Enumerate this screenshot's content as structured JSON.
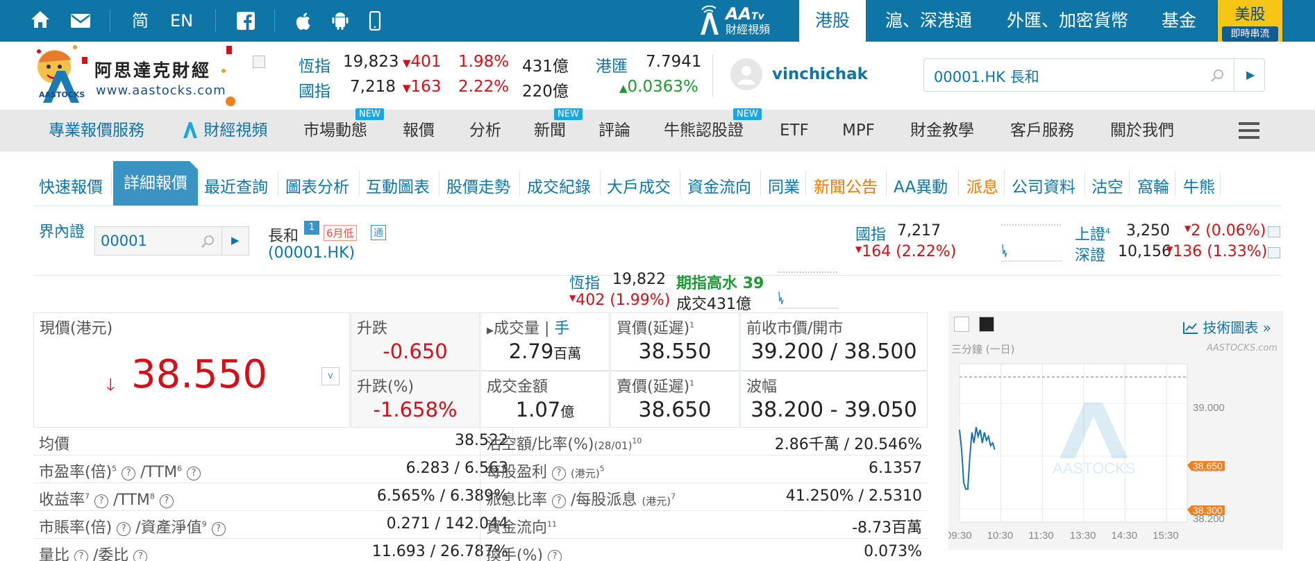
{
  "topbar": {
    "home_icon": "home-icon",
    "mail_icon": "mail-icon",
    "lang_sc": "简",
    "lang_en": "EN",
    "facebook_icon": "facebook-icon",
    "apple_icon": "apple-icon",
    "android_icon": "android-icon",
    "mobile_icon": "mobile-icon",
    "aatv_logo": "AA",
    "aatv_logo_sub": "Tv",
    "aatv_label": "財經視頻",
    "nav": [
      "港股",
      "滬、深港通",
      "外匯、加密貨幣",
      "基金"
    ],
    "us_badge_top": "美股",
    "us_badge_bottom": "即時串流"
  },
  "header": {
    "logo_cn": "阿思達克財經",
    "logo_url": "www.aastocks.com",
    "logo_mark": "AASTOCKS",
    "quotes": [
      {
        "label": "恆指",
        "value": "19,823",
        "change": "401",
        "pct": "1.98%",
        "turnover": "431億"
      },
      {
        "label": "國指",
        "value": "7,218",
        "change": "163",
        "pct": "2.22%",
        "turnover": "220億"
      }
    ],
    "fx_label": "港匯",
    "fx_value": "7.7941",
    "fx_change": "0.0363%",
    "username": "vinchichak",
    "search_value": "00001.HK 長和"
  },
  "mainnav": {
    "items": [
      "專業報價服務",
      "財經視頻",
      "市場動態",
      "報價",
      "分析",
      "新聞",
      "評論",
      "牛熊認股證",
      "ETF",
      "MPF",
      "財金教學",
      "客戶服務",
      "關於我們"
    ],
    "new_label": "NEW"
  },
  "subtabs": [
    "快速報價",
    "詳細報價",
    "最近查詢",
    "圖表分析",
    "互動圖表",
    "股價走勢",
    "成交紀錄",
    "大戶成交",
    "資金流向",
    "同業",
    "新聞公告",
    "AA異動",
    "派息",
    "公司資料",
    "沽空",
    "窩輪",
    "牛熊"
  ],
  "stock_search": {
    "label": "界內證",
    "value": "00001"
  },
  "stock": {
    "name": "長和",
    "code": "(00001.HK)",
    "badge_num": "1",
    "badge_low": "6月低",
    "badge_t": "通"
  },
  "mini_index": {
    "hsce_label": "國指",
    "hsce_value": "7,217",
    "hsce_change": "164 (2.22%)",
    "sh_label": "上證",
    "sh_sup": "4",
    "sh_value": "3,250",
    "sh_change": "2 (0.06%)",
    "sz_label": "深證",
    "sz_value": "10,156",
    "sz_change": "136 (1.33%)",
    "hsi_label": "恆指",
    "hsi_value": "19,822",
    "hsi_change": "402 (1.99%)",
    "futures_label": "期指高水",
    "futures_value": "39",
    "turnover_label": "成交",
    "turnover_value": "431億"
  },
  "quote": {
    "price_label": "現價(港元)",
    "price": "38.550",
    "change_label": "升跌",
    "change": "-0.650",
    "pct_label": "升跌(%)",
    "pct": "-1.658%",
    "volume_label": "成交量",
    "volume_unit_label": "手",
    "volume": "2.79",
    "volume_unit": "百萬",
    "bid_label": "買價(延遲)",
    "bid": "38.550",
    "prev_label": "前收市價/開市",
    "prev": "39.200 / 38.500",
    "turnover_label": "成交金額",
    "turnover": "1.07",
    "turnover_unit": "億",
    "ask_label": "賣價(延遲)",
    "ask": "38.650",
    "range_label": "波幅",
    "range": "38.200 - 39.050"
  },
  "rows": [
    {
      "l1": "均價",
      "v1": "38.522",
      "l2": "沽空額/比率(%)",
      "l2s": "(28/01)",
      "l2sup": "10",
      "v2": "2.86千萬 / 20.546%"
    },
    {
      "l1": "市盈率(倍)",
      "l1sup": "5",
      "l1b": "/TTM",
      "l1bsup": "6",
      "v1": "6.283 / 6.563",
      "l2": "每股盈利",
      "l2s": "(港元)",
      "l2sup": "5",
      "v2": "6.1357"
    },
    {
      "l1": "收益率",
      "l1sup": "7",
      "l1b": "/TTM",
      "l1bsup": "8",
      "v1": "6.565% / 6.389%",
      "l2": "派息比率",
      "l2b": "/每股派息",
      "l2s": "(港元)",
      "l2sup": "7",
      "v2": "41.250% / 2.5310"
    },
    {
      "l1": "市賬率(倍)",
      "l1b": "/資產淨值",
      "l1bsup": "9",
      "v1": "0.271 / 142.044",
      "l2": "資金流向",
      "l2sup": "11",
      "v2": "-8.73百萬"
    },
    {
      "l1": "量比",
      "l1b": "/委比",
      "v1": "11.693 / 26.787%",
      "l2": "換手(%)",
      "v2": "0.073%"
    }
  ],
  "chart": {
    "link_label": "技術圖表 »",
    "title": "三分鐘 (一日)",
    "watermark": "AASTOCKS.com",
    "center_watermark": "AASTOCKS",
    "y_ticks": [
      "39.000",
      "38.200"
    ],
    "tag_high": "38.650",
    "tag_low": "38.300",
    "tag_hidden": "38.600",
    "x_ticks": [
      "09:30",
      "10:30",
      "11:30",
      "13:30",
      "14:30",
      "15:30"
    ]
  },
  "chart_data": {
    "type": "line",
    "title": "三分鐘 (一日)",
    "xlabel": "",
    "ylabel": "",
    "x_ticks": [
      "09:30",
      "10:30",
      "11:30",
      "13:30",
      "14:30",
      "15:30"
    ],
    "ylim": [
      38.1,
      39.3
    ],
    "prev_close": 39.2,
    "series": [
      {
        "x": [
          "09:30",
          "09:33",
          "09:36",
          "09:39",
          "09:42",
          "09:45",
          "09:48",
          "09:51",
          "09:54",
          "09:57",
          "10:00",
          "10:03",
          "10:06",
          "10:09",
          "10:12",
          "10:15",
          "10:18",
          "10:21"
        ],
        "values": [
          38.8,
          38.65,
          38.4,
          38.35,
          38.35,
          38.6,
          38.78,
          38.7,
          38.82,
          38.75,
          38.8,
          38.7,
          38.78,
          38.72,
          38.75,
          38.68,
          38.7,
          38.65
        ]
      }
    ]
  }
}
